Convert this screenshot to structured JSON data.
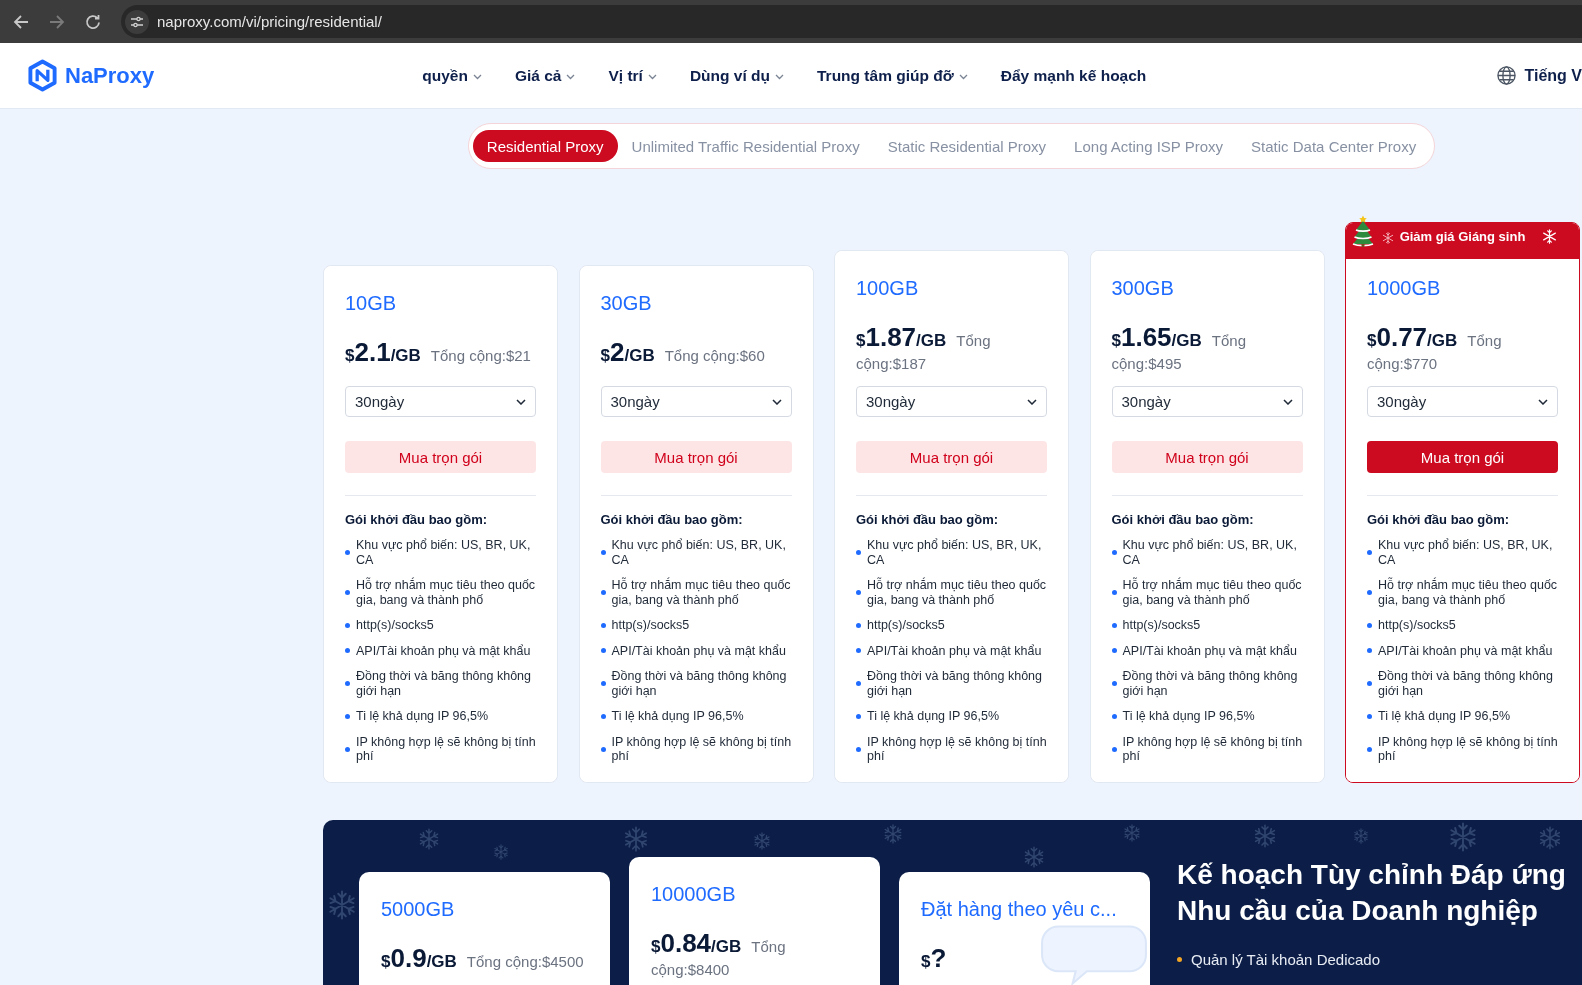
{
  "browser": {
    "url": "naproxy.com/vi/pricing/residential/",
    "forward_disabled": true
  },
  "header": {
    "logo": "NaProxy",
    "nav": [
      {
        "label": "quyền",
        "dropdown": true
      },
      {
        "label": "Giá cả",
        "dropdown": true
      },
      {
        "label": "Vị trí",
        "dropdown": true
      },
      {
        "label": "Dùng ví dụ",
        "dropdown": true
      },
      {
        "label": "Trung tâm giúp đỡ",
        "dropdown": true
      },
      {
        "label": "Đẩy mạnh kế hoạch",
        "dropdown": false
      }
    ],
    "language": "Tiếng V"
  },
  "product_tabs": [
    {
      "label": "Residential Proxy",
      "selected": true
    },
    {
      "label": "Unlimited Traffic Residential Proxy",
      "selected": false
    },
    {
      "label": "Static Residential Proxy",
      "selected": false
    },
    {
      "label": "Long Acting ISP Proxy",
      "selected": false
    },
    {
      "label": "Static Data Center Proxy",
      "selected": false
    }
  ],
  "plans": [
    {
      "size": "10GB",
      "currency": "$",
      "price": "2.1",
      "unit": "/GB",
      "total": "Tổng cộng:$21",
      "duration": "30ngày",
      "button": "Mua trọn gói",
      "highlighted": false,
      "features_title": "Gói khởi đầu bao gồm:",
      "features": [
        "Khu vực phổ biến: US, BR, UK, CA",
        "Hỗ trợ nhắm mục tiêu theo quốc gia, bang và thành phố",
        "http(s)/socks5",
        "API/Tài khoản phụ và mật khẩu",
        "Đồng thời và băng thông không giới hạn",
        "Ti lệ khả dụng IP 96,5%",
        "IP không hợp lệ sẽ không bị tính phí"
      ]
    },
    {
      "size": "30GB",
      "currency": "$",
      "price": "2",
      "unit": "/GB",
      "total": "Tổng cộng:$60",
      "duration": "30ngày",
      "button": "Mua trọn gói",
      "highlighted": false,
      "features_title": "Gói khởi đầu bao gồm:",
      "features": [
        "Khu vực phổ biến: US, BR, UK, CA",
        "Hỗ trợ nhắm mục tiêu theo quốc gia, bang và thành phố",
        "http(s)/socks5",
        "API/Tài khoản phụ và mật khẩu",
        "Đồng thời và băng thông không giới hạn",
        "Ti lệ khả dụng IP 96,5%",
        "IP không hợp lệ sẽ không bị tính phí"
      ]
    },
    {
      "size": "100GB",
      "currency": "$",
      "price": "1.87",
      "unit": "/GB",
      "total": "Tổng cộng:$187",
      "duration": "30ngày",
      "button": "Mua trọn gói",
      "highlighted": false,
      "features_title": "Gói khởi đầu bao gồm:",
      "features": [
        "Khu vực phổ biến: US, BR, UK, CA",
        "Hỗ trợ nhắm mục tiêu theo quốc gia, bang và thành phố",
        "http(s)/socks5",
        "API/Tài khoản phụ và mật khẩu",
        "Đồng thời và băng thông không giới hạn",
        "Ti lệ khả dụng IP 96,5%",
        "IP không hợp lệ sẽ không bị tính phí"
      ]
    },
    {
      "size": "300GB",
      "currency": "$",
      "price": "1.65",
      "unit": "/GB",
      "total": "Tổng cộng:$495",
      "duration": "30ngày",
      "button": "Mua trọn gói",
      "highlighted": false,
      "features_title": "Gói khởi đầu bao gồm:",
      "features": [
        "Khu vực phổ biến: US, BR, UK, CA",
        "Hỗ trợ nhắm mục tiêu theo quốc gia, bang và thành phố",
        "http(s)/socks5",
        "API/Tài khoản phụ và mật khẩu",
        "Đồng thời và băng thông không giới hạn",
        "Ti lệ khả dụng IP 96,5%",
        "IP không hợp lệ sẽ không bị tính phí"
      ]
    },
    {
      "size": "1000GB",
      "currency": "$",
      "price": "0.77",
      "unit": "/GB",
      "total": "Tổng cộng:$770",
      "duration": "30ngày",
      "button": "Mua trọn gói",
      "highlighted": true,
      "badge": "Giảm giá Giáng sinh",
      "features_title": "Gói khởi đầu bao gồm:",
      "features": [
        "Khu vực phổ biến: US, BR, UK, CA",
        "Hỗ trợ nhắm mục tiêu theo quốc gia, bang và thành phố",
        "http(s)/socks5",
        "API/Tài khoản phụ và mật khẩu",
        "Đồng thời và băng thông không giới hạn",
        "Ti lệ khả dụng IP 96,5%",
        "IP không hợp lệ sẽ không bị tính phí"
      ]
    }
  ],
  "enterprise": {
    "plans": [
      {
        "kind": "standard",
        "size": "5000GB",
        "currency": "$",
        "price": "0.9",
        "unit": "/GB",
        "total": "Tổng cộng:$4500"
      },
      {
        "kind": "standard",
        "size": "10000GB",
        "currency": "$",
        "price": "0.84",
        "unit": "/GB",
        "total": "Tổng cộng:$8400"
      },
      {
        "kind": "custom",
        "size": "Đặt hàng theo yêu c...",
        "currency": "$",
        "price": "?"
      }
    ],
    "title": "Kế hoạch Tùy chỉnh Đáp ứng Nhu cầu của Doanh nghiệp",
    "benefits": [
      "Quản lý Tài khoản Dedicado"
    ]
  }
}
